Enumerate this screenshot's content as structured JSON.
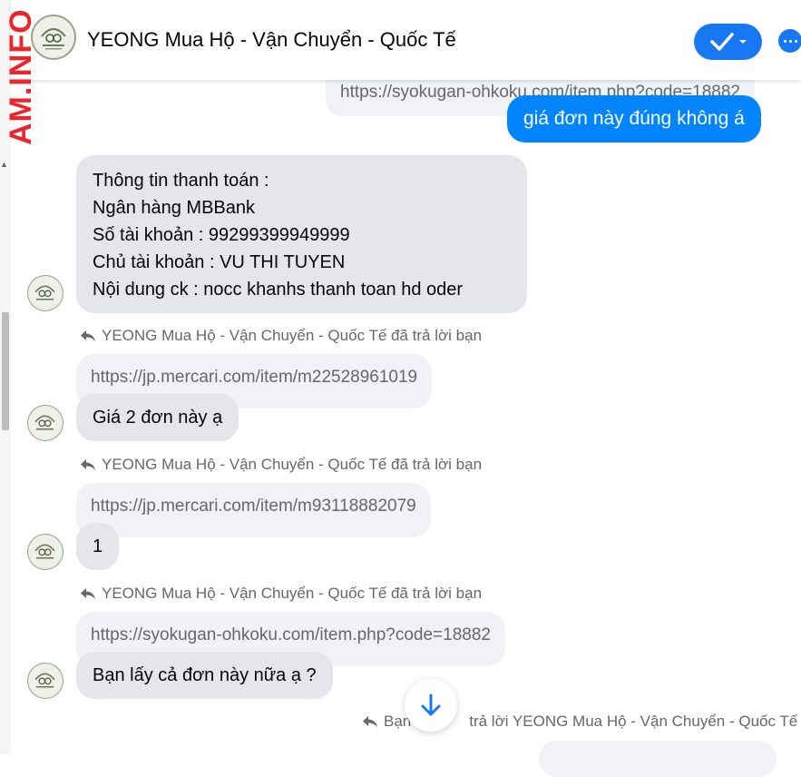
{
  "watermark": "AM.INFO",
  "header": {
    "title": "YEONG Mua Hộ - Vận Chuyển - Quốc Tế",
    "accent": "#1877f2"
  },
  "messages": {
    "top_quote": "https://syokugan-ohkoku.com/item.php?code=18882",
    "outgoing_1": "giá đơn này đúng không á",
    "payment_info": [
      "Thông tin thanh toán :",
      "Ngân hàng MBBank",
      "Số tài khoản : 99299399949999",
      "Chủ tài khoản : VU THI TUYEN",
      "Nội dung ck : nocc khanhs thanh toan hd oder"
    ],
    "reply_notes": [
      "YEONG Mua Hộ - Vận Chuyển - Quốc Tế đã trả lời bạn",
      "YEONG Mua Hộ - Vận Chuyển - Quốc Tế đã trả lời bạn",
      "YEONG Mua Hộ - Vận Chuyển - Quốc Tế đã trả lời bạn"
    ],
    "quoted": [
      "https://jp.mercari.com/item/m22528961019",
      "https://jp.mercari.com/item/m93118882079",
      "https://syokugan-ohkoku.com/item.php?code=18882"
    ],
    "replies": [
      "Giá 2 đơn này ạ",
      "1",
      "Bạn lấy cả đơn này nữa ạ ?"
    ],
    "bottom_note_prefix": "Bạn",
    "bottom_note_suffix": "trả lời YEONG Mua Hộ - Vận Chuyển - Quốc Tế"
  },
  "icons": {
    "check": "check-icon",
    "more": "more-icon",
    "reply": "reply-arrow-icon",
    "scroll": "arrow-down-icon"
  }
}
